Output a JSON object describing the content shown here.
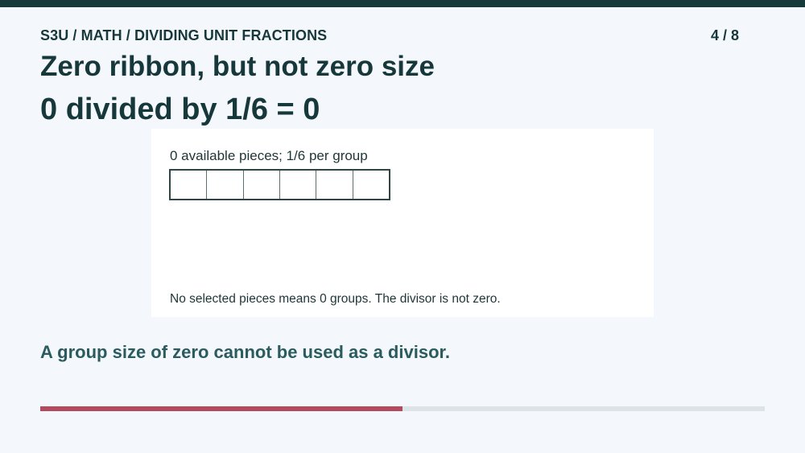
{
  "header": {
    "breadcrumb": "S3U / MATH / DIVIDING UNIT FRACTIONS",
    "page_counter": "4 / 8"
  },
  "slide": {
    "title": "Zero ribbon, but not zero size",
    "equation": "0 divided by 1/6 = 0",
    "card": {
      "caption": "0 available pieces; 1/6 per group",
      "ribbon": {
        "total_cells": 6,
        "selected_cells": 0
      },
      "note": "No selected pieces means 0 groups. The divisor is not zero."
    },
    "takeaway": "A group size of zero cannot be used as a divisor."
  },
  "progress": {
    "current": 4,
    "total": 8,
    "fraction": 0.5
  },
  "colors": {
    "top_bar": "#163a3a",
    "background": "#f4f8fc",
    "text_dark": "#17383a",
    "takeaway_text": "#2a5b5e",
    "progress_fill": "#b54a5f",
    "progress_track": "#dde4e8"
  }
}
